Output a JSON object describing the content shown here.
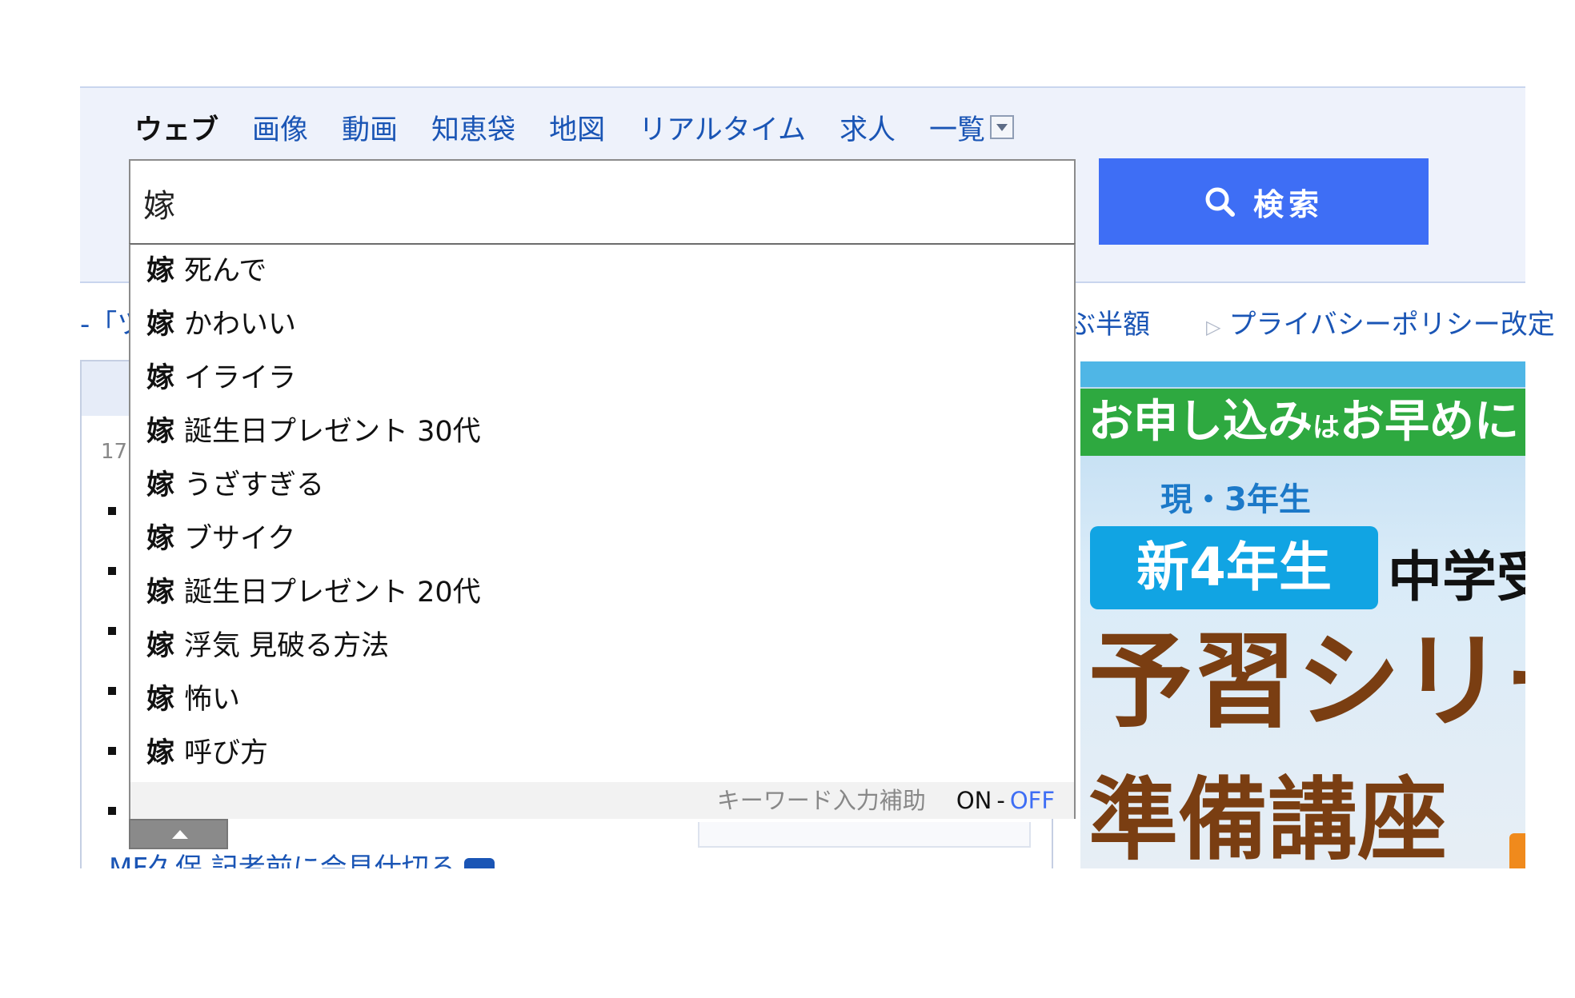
{
  "header": {
    "tabs": [
      {
        "label": "ウェブ",
        "active": true
      },
      {
        "label": "画像"
      },
      {
        "label": "動画"
      },
      {
        "label": "知恵袋"
      },
      {
        "label": "地図"
      },
      {
        "label": "リアルタイム"
      },
      {
        "label": "求人"
      },
      {
        "label": "一覧"
      }
    ],
    "search_value": "嫁",
    "search_button_label": "検索"
  },
  "suggestions": [
    {
      "keyword": "嫁",
      "rest": "死んで"
    },
    {
      "keyword": "嫁",
      "rest": "かわいい"
    },
    {
      "keyword": "嫁",
      "rest": "イライラ"
    },
    {
      "keyword": "嫁",
      "rest": "誕生日プレゼント 30代"
    },
    {
      "keyword": "嫁",
      "rest": "うざすぎる"
    },
    {
      "keyword": "嫁",
      "rest": "ブサイク"
    },
    {
      "keyword": "嫁",
      "rest": "誕生日プレゼント 20代"
    },
    {
      "keyword": "嫁",
      "rest": "浮気 見破る方法"
    },
    {
      "keyword": "嫁",
      "rest": "怖い"
    },
    {
      "keyword": "嫁",
      "rest": "呼び方"
    }
  ],
  "suggest_footer": {
    "label": "キーワード入力補助",
    "on": "ON",
    "separator": "-",
    "off": "OFF"
  },
  "background": {
    "topline_left": "-「ツ",
    "topline_right_1": "ぶ半額",
    "topline_right_2": "プライバシーポリシー改定",
    "small_number": "17",
    "bottom_news": "MF久保 記者前に会見仕切る"
  },
  "ad": {
    "banner": "お申し込み",
    "banner_small": "は",
    "banner_end": "お早めに！",
    "grade": "現・3年生",
    "new_grade": "新4年生",
    "exam": "中学受",
    "title1": "予習シリー",
    "title2": "準備講座"
  },
  "colors": {
    "accent": "#3e6ef5",
    "link": "#1a55b5",
    "header_bg": "#eef2fb"
  }
}
